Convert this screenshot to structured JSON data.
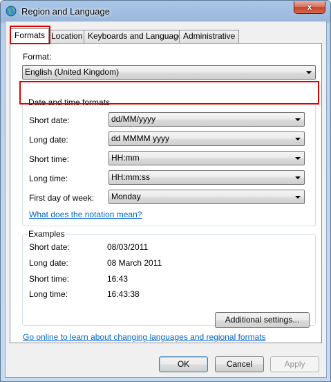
{
  "window": {
    "title": "Region and Language",
    "close_glyph": "x"
  },
  "tabs": [
    {
      "label": "Formats",
      "active": true
    },
    {
      "label": "Location",
      "active": false
    },
    {
      "label": "Keyboards and Languages",
      "active": false
    },
    {
      "label": "Administrative",
      "active": false
    }
  ],
  "formats": {
    "format_label": "Format:",
    "format_value": "English (United Kingdom)",
    "date_time_group": {
      "title": "Date and time formats",
      "rows": [
        {
          "label": "Short date:",
          "value": "dd/MM/yyyy"
        },
        {
          "label": "Long date:",
          "value": "dd MMMM yyyy"
        },
        {
          "label": "Short time:",
          "value": "HH:mm"
        },
        {
          "label": "Long time:",
          "value": "HH:mm:ss"
        },
        {
          "label": "First day of week:",
          "value": "Monday"
        }
      ],
      "notation_link": "What does the notation mean?"
    },
    "examples_group": {
      "title": "Examples",
      "rows": [
        {
          "label": "Short date:",
          "value": "08/03/2011"
        },
        {
          "label": "Long date:",
          "value": "08 March 2011"
        },
        {
          "label": "Short time:",
          "value": "16:43"
        },
        {
          "label": "Long time:",
          "value": "16:43:38"
        }
      ]
    },
    "additional_settings": "Additional settings...",
    "online_link": "Go online to learn about changing languages and regional formats"
  },
  "buttons": {
    "ok": "OK",
    "cancel": "Cancel",
    "apply": "Apply"
  },
  "colors": {
    "highlight": "#e00000",
    "link": "#0066cc"
  }
}
